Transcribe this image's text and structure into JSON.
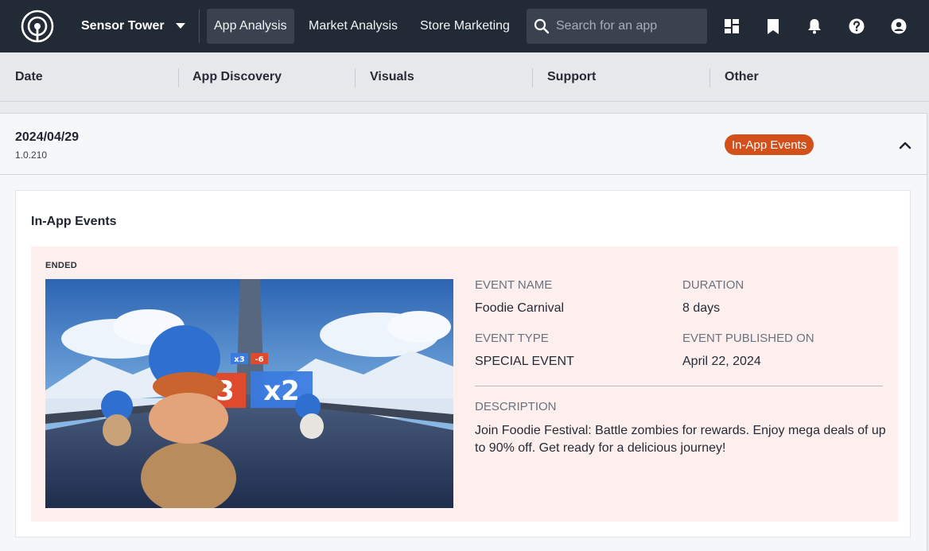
{
  "nav": {
    "brand": "Sensor Tower",
    "items": [
      {
        "label": "App Analysis",
        "active": true
      },
      {
        "label": "Market Analysis",
        "active": false
      },
      {
        "label": "Store Marketing",
        "active": false
      }
    ],
    "search_placeholder": "Search for an app",
    "icons": [
      "dashboard-icon",
      "bookmark-icon",
      "bell-icon",
      "help-icon",
      "account-icon"
    ]
  },
  "columns": [
    "Date",
    "App Discovery",
    "Visuals",
    "Support",
    "Other"
  ],
  "row": {
    "date": "2024/04/29",
    "version": "1.0.210",
    "badge": "In-App Events",
    "badge_color": "#d4501a"
  },
  "panel": {
    "title": "In-App Events",
    "event": {
      "status": "ENDED",
      "name_label": "EVENT NAME",
      "name": "Foodie Carnival",
      "duration_label": "DURATION",
      "duration": "8 days",
      "type_label": "EVENT TYPE",
      "type": "SPECIAL EVENT",
      "published_label": "EVENT PUBLISHED ON",
      "published": "April 22, 2024",
      "description_label": "DESCRIPTION",
      "description": "Join Foodie Festival: Battle zombies for rewards. Enjoy mega deals of up to 90% off. Get ready for a delicious journey!",
      "art_text_left": "3",
      "art_text_right": "x2",
      "art_mini_left": "x3",
      "art_mini_right": "-6"
    }
  }
}
